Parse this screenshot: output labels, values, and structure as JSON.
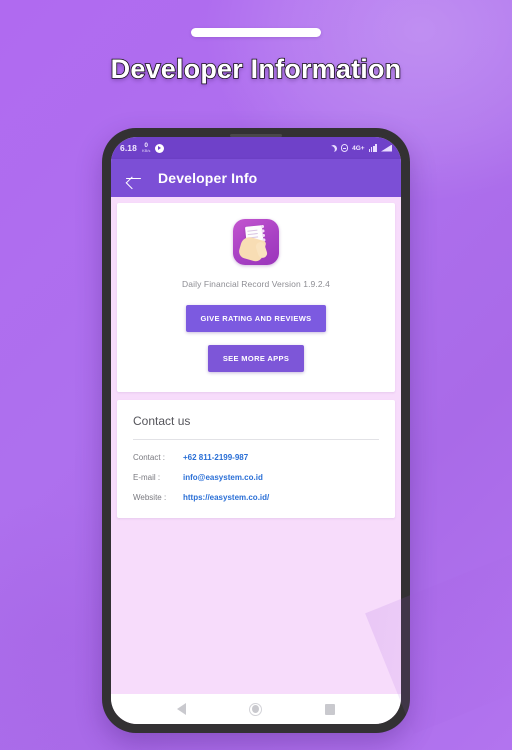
{
  "promo": {
    "headline": "Developer Information"
  },
  "phone": {
    "status_bar": {
      "time": "6.18",
      "network_speed_value": "0",
      "network_speed_unit": "KB/s",
      "play_icon": "play-circle-icon",
      "moon_icon": "moon-icon",
      "dnd_icon": "do-not-disturb-icon",
      "network_type": "4G+",
      "signal_icon": "signal-bars-icon",
      "battery_icon": "battery-icon"
    },
    "app_bar": {
      "back_icon": "back-arrow-icon",
      "title": "Developer Info"
    },
    "app_card": {
      "app_icon": "daily-financial-record-app-icon",
      "version_text": "Daily Financial Record Version 1.9.2.4",
      "rate_button": "GIVE RATING AND REVIEWS",
      "more_apps_button": "SEE MORE APPS"
    },
    "contact_card": {
      "title": "Contact us",
      "rows": [
        {
          "label": "Contact :",
          "value": "+62 811-2199-987"
        },
        {
          "label": "E-mail   :",
          "value": "info@easystem.co.id"
        },
        {
          "label": "Website :",
          "value": "https://easystem.co.id/"
        }
      ]
    },
    "nav_bar": {
      "back": "nav-back-icon",
      "home": "nav-home-icon",
      "recents": "nav-recents-icon"
    }
  },
  "colors": {
    "promo_background": "#ae70ee",
    "status_bar": "#6f41c9",
    "app_bar": "#7c4fd6",
    "screen_background": "#f7dcfb",
    "card": "#ffffff",
    "button": "#7c5ae0",
    "link": "#2a6fd6"
  }
}
